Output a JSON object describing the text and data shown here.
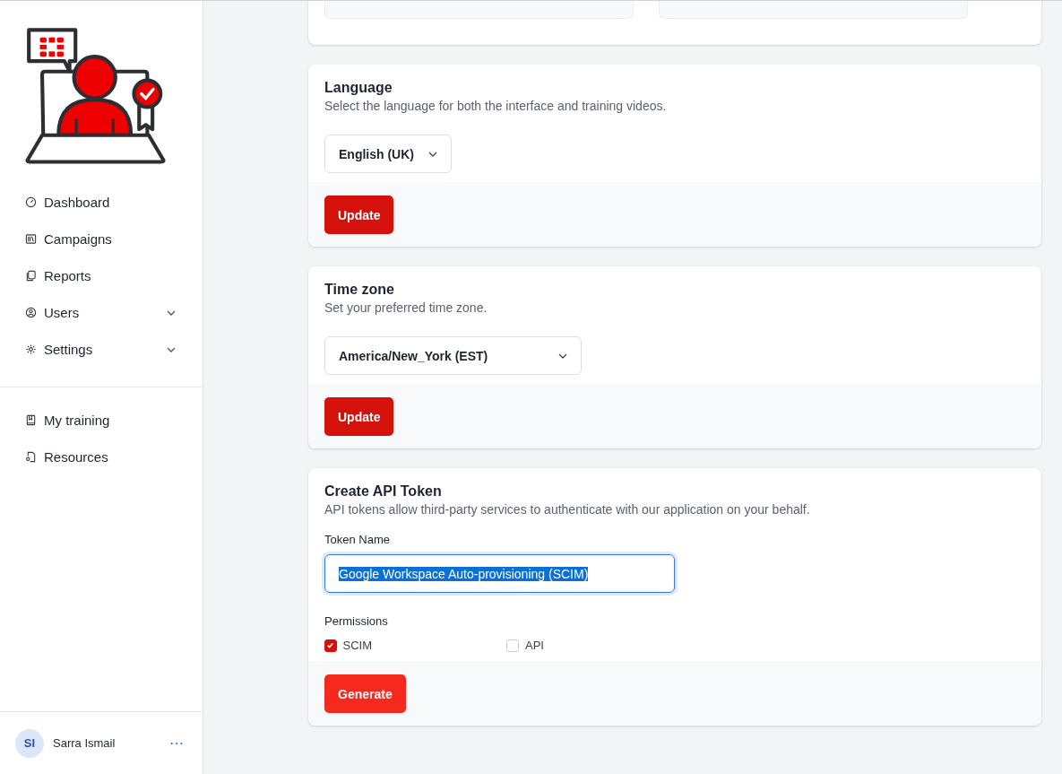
{
  "sidebar": {
    "items": [
      {
        "label": "Dashboard",
        "expandable": false
      },
      {
        "label": "Campaigns",
        "expandable": false
      },
      {
        "label": "Reports",
        "expandable": false
      },
      {
        "label": "Users",
        "expandable": true
      },
      {
        "label": "Settings",
        "expandable": true
      }
    ],
    "secondary_items": [
      {
        "label": "My training"
      },
      {
        "label": "Resources"
      }
    ],
    "user": {
      "initials": "SI",
      "name": "Sarra Ismail",
      "menu": "⋯"
    }
  },
  "cards": [
    {
      "kind": "select",
      "title": "Language",
      "description": "Select the language for both the interface and training videos.",
      "value": "English (UK)",
      "button": "Update"
    },
    {
      "kind": "select",
      "title": "Time zone",
      "description": "Set your preferred time zone.",
      "value": "America/New_York (EST)",
      "button": "Update"
    },
    {
      "kind": "token",
      "title": "Create API Token",
      "description": "API tokens allow third-party services to authenticate with our application on your behalf.",
      "field_label": "Token Name",
      "value": "Google Workspace Auto-provisioning (SCIM)",
      "permissions_label": "Permissions",
      "permissions": [
        {
          "label": "SCIM",
          "checked": true
        },
        {
          "label": "API",
          "checked": false
        }
      ],
      "button": "Generate"
    }
  ]
}
